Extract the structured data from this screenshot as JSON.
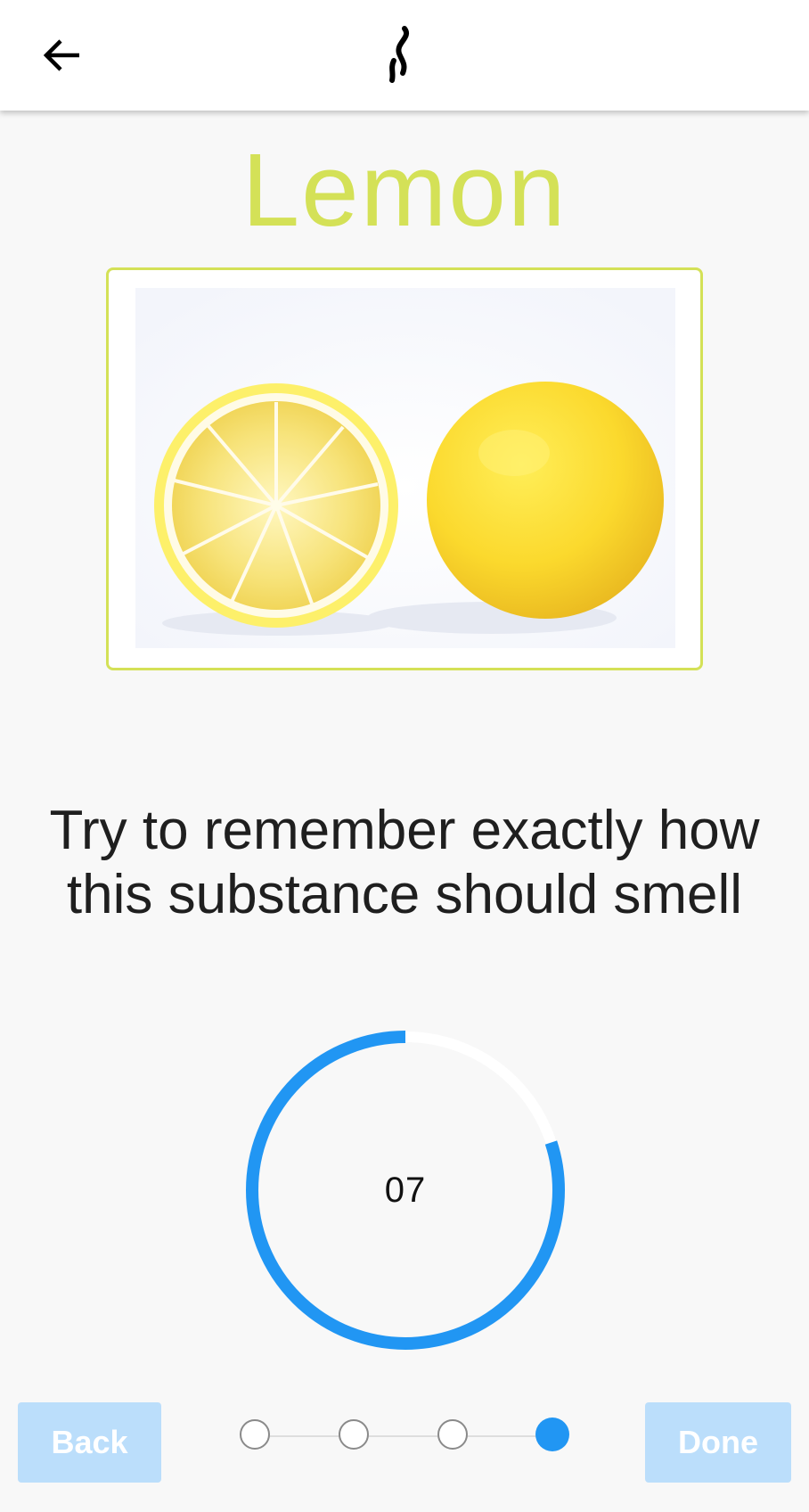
{
  "app": {
    "back_icon": "arrow-left-icon",
    "logo_icon": "smell-wave-icon"
  },
  "scent": {
    "name": "Lemon",
    "color": "#d4e157",
    "image_description": "lemon-halves-photo"
  },
  "instruction": {
    "line1": "Try to remember exactly how",
    "line2": "this substance should smell"
  },
  "timer": {
    "value": "07",
    "progress_fraction": 0.8,
    "ring_color": "#2196f3",
    "track_color": "#ffffff"
  },
  "stepper": {
    "total": 4,
    "current": 4,
    "active_color": "#2196f3"
  },
  "buttons": {
    "back_label": "Back",
    "done_label": "Done",
    "disabled_color": "#bbdefb"
  }
}
